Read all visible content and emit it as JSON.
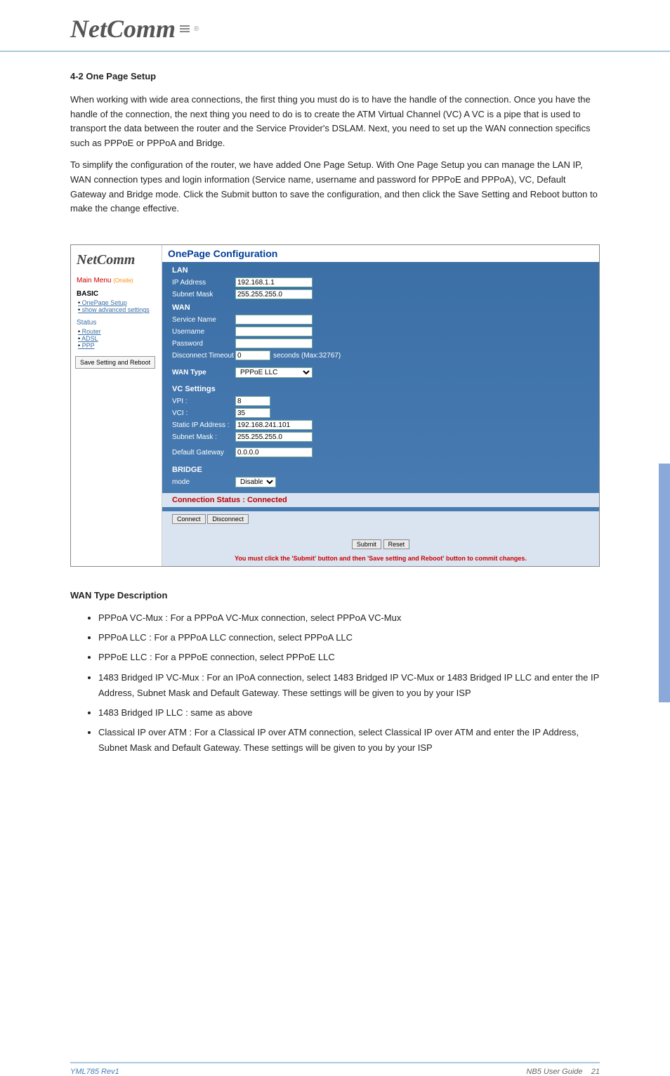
{
  "logo": "NetComm",
  "logo_r": "®",
  "intro": {
    "heading": "4-2     One Page Setup",
    "p1": "When working with wide area connections, the first thing you must do is to have the handle of the connection. Once you have the handle of the connection, the next thing you need to do is to create the ATM Virtual Channel (VC) A VC is a pipe that is used to transport the data between the router and the Service Provider's DSLAM. Next, you need to set up the WAN connection specifics such as PPPoE or PPPoA and Bridge.",
    "p2": "To simplify the configuration of the router, we have added One Page Setup. With One Page Setup you can manage the LAN IP, WAN connection types and login information (Service name, username and password for PPPoE and PPPoA), VC, Default Gateway and Bridge mode. Click the Submit button to save the configuration, and then click the Save Setting and Reboot button to make the change effective."
  },
  "menu": {
    "logo": "NetComm",
    "main": "Main Menu",
    "site": "(Onsite)",
    "basic": "BASIC",
    "onepage": "OnePage Setup",
    "showadv": "show advanced settings",
    "status": "Status",
    "router": "Router",
    "adsl": "ADSL",
    "ppp": "PPP",
    "save": "Save Setting and Reboot"
  },
  "cfg": {
    "title": "OnePage Configuration",
    "lan": "LAN",
    "ip_label": "IP Address",
    "ip_val": "192.168.1.1",
    "mask_label": "Subnet Mask",
    "mask_val": "255.255.255.0",
    "wan": "WAN",
    "svc_label": "Service Name",
    "svc_val": "",
    "user_label": "Username",
    "user_val": "",
    "pwd_label": "Password",
    "pwd_val": "",
    "dto_label": "Disconnect Timeout",
    "dto_val": "0",
    "dto_suffix": "seconds (Max:32767)",
    "wantype_label": "WAN Type",
    "wantype_val": "PPPoE LLC",
    "vc": "VC Settings",
    "vpi_label": "VPI :",
    "vpi_val": "8",
    "vci_label": "VCI :",
    "vci_val": "35",
    "sip_label": "Static IP Address :",
    "sip_val": "192.168.241.101",
    "smask_label": "Subnet Mask :",
    "smask_val": "255.255.255.0",
    "gw_label": "Default Gateway",
    "gw_val": "0.0.0.0",
    "bridge": "BRIDGE",
    "bmode_label": "mode",
    "bmode_val": "Disabled",
    "conn_status": "Connection Status : Connected",
    "connect": "Connect",
    "disconnect": "Disconnect",
    "submit": "Submit",
    "reset": "Reset",
    "warn": "You must click the 'Submit' button and then 'Save setting and Reboot' button to commit changes."
  },
  "post": {
    "heading": "WAN Type Description",
    "items": [
      "PPPoA VC-Mux : For a PPPoA VC-Mux connection, select PPPoA VC-Mux",
      "PPPoA LLC : For a PPPoA LLC connection, select PPPoA LLC",
      "PPPoE LLC : For a PPPoE connection, select PPPoE LLC",
      "1483 Bridged IP VC-Mux : For an IPoA connection, select 1483 Bridged IP VC-Mux or 1483 Bridged IP LLC and enter the IP Address, Subnet Mask and Default Gateway. These settings will be given to you by your ISP",
      "1483 Bridged IP LLC : same as above",
      "Classical IP over ATM : For a Classical IP over ATM connection, select Classical IP over ATM and enter the IP Address, Subnet Mask and Default Gateway. These settings will be given to you by your ISP"
    ]
  },
  "footer": {
    "left": "YML785 Rev1",
    "right_prefix": "NB5 User Guide",
    "right_page": "21"
  }
}
